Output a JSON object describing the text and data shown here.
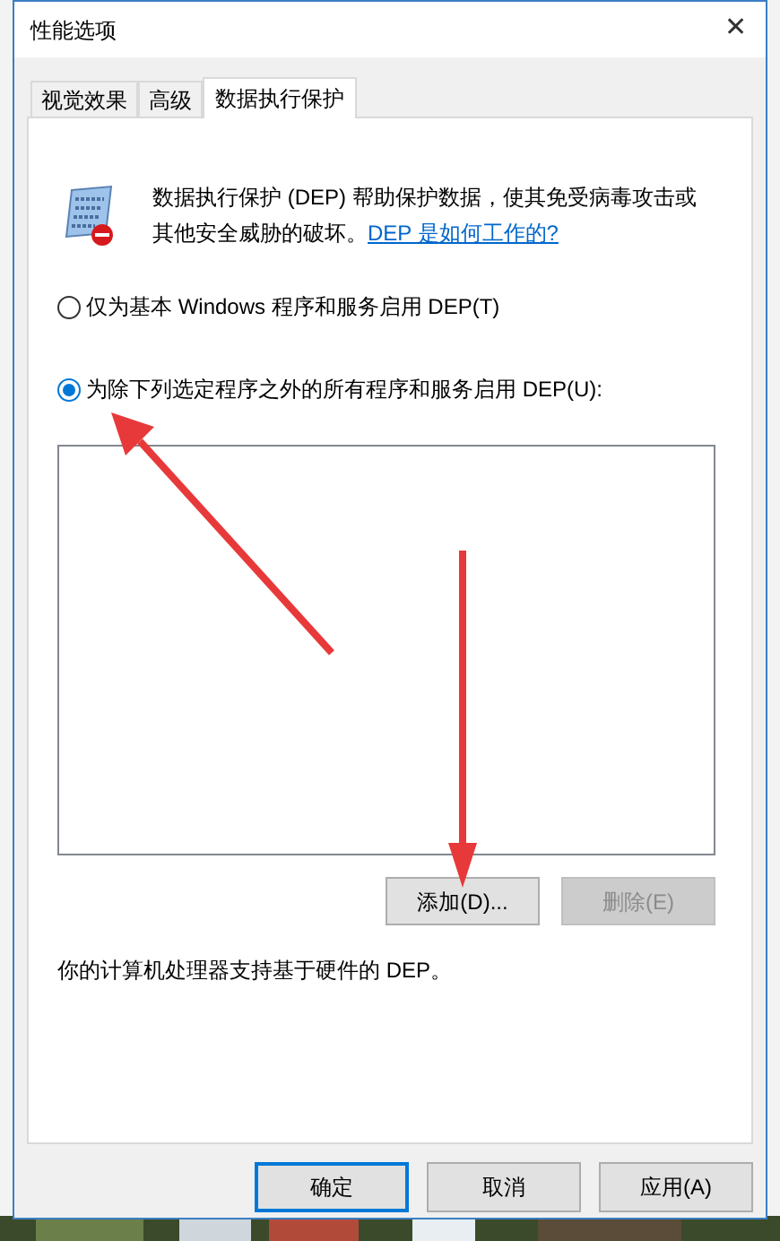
{
  "window": {
    "title": "性能选项",
    "close": "✕"
  },
  "tabs": [
    {
      "label": "视觉效果",
      "selected": false
    },
    {
      "label": "高级",
      "selected": false
    },
    {
      "label": "数据执行保护",
      "selected": true
    }
  ],
  "intro": {
    "text": "数据执行保护 (DEP) 帮助保护数据，使其免受病毒攻击或其他安全威胁的破坏。",
    "link": "DEP 是如何工作的?"
  },
  "options": [
    {
      "label": "仅为基本 Windows 程序和服务启用 DEP(T)",
      "selected": false
    },
    {
      "label": "为除下列选定程序之外的所有程序和服务启用 DEP(U):",
      "selected": true
    }
  ],
  "list_buttons": [
    {
      "label": "添加(D)...",
      "disabled": false
    },
    {
      "label": "删除(E)",
      "disabled": true
    }
  ],
  "support_note": "你的计算机处理器支持基于硬件的 DEP。",
  "footer_buttons": [
    {
      "label": "确定",
      "default": true
    },
    {
      "label": "取消",
      "default": false
    },
    {
      "label": "应用(A)",
      "default": false
    }
  ]
}
